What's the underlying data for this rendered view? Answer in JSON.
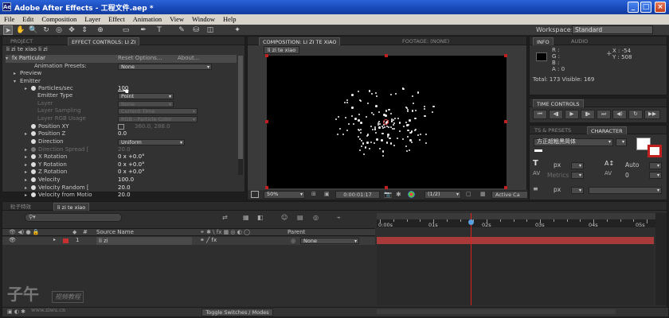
{
  "app": {
    "title": "Adobe After Effects - 工程文件.aep *",
    "minimize": "_",
    "maximize": "□",
    "close": "×"
  },
  "menu": [
    "File",
    "Edit",
    "Composition",
    "Layer",
    "Effect",
    "Animation",
    "View",
    "Window",
    "Help"
  ],
  "toolbar": {
    "workspace_label": "Workspace:",
    "workspace_value": "Standard"
  },
  "left_panel": {
    "tabs": [
      "PROJECT",
      "EFFECT CONTROLS: li zi"
    ],
    "breadcrumb": "li zi te xiao  li zi",
    "effect_name": "Particular",
    "reset": "Reset Options...",
    "about": "About...",
    "presets_label": "Animation Presets:",
    "presets_value": "None",
    "sections": {
      "preview": "Preview",
      "emitter": "Emitter"
    },
    "properties": [
      {
        "label": "Particles/sec",
        "value": "100"
      },
      {
        "label": "Emitter Type",
        "value": "Point"
      },
      {
        "label": "Layer",
        "value": "None"
      },
      {
        "label": "Layer Sampling",
        "value": "Current Time"
      },
      {
        "label": "Layer RGB Usage",
        "value": "RGB - Particle Color"
      },
      {
        "label": "Position XY",
        "value": "360.0, 288.0"
      },
      {
        "label": "Position Z",
        "value": "0.0"
      },
      {
        "label": "Direction",
        "value": "Uniform"
      },
      {
        "label": "Direction Spread [",
        "value": "20.0"
      },
      {
        "label": "X Rotation",
        "value": "0 x +0.0°"
      },
      {
        "label": "Y Rotation",
        "value": "0 x +0.0°"
      },
      {
        "label": "Z Rotation",
        "value": "0 x +0.0°"
      },
      {
        "label": "Velocity",
        "value": "100.0"
      },
      {
        "label": "Velocity Random [",
        "value": "20.0"
      },
      {
        "label": "Velocity from Motio",
        "value": "20.0"
      }
    ]
  },
  "comp_panel": {
    "tab_active": "COMPOSITION: li zi te xiao",
    "tab_footage": "FOOTAGE: (none)",
    "comp_name": "li zi te xiao",
    "zoom": "50%",
    "timecode": "0:00:01:17",
    "resolution": "(1/2)",
    "view": "Active Ca"
  },
  "info_panel": {
    "tabs": [
      "INFO",
      "AUDIO"
    ],
    "r": "R :",
    "g": "G :",
    "b": "B :",
    "a": "A : 0",
    "x": "X : -54",
    "y": "Y : 508",
    "total": "Total: 173   Visible: 169"
  },
  "time_controls": {
    "tab": "TIME CONTROLS"
  },
  "character_panel": {
    "tabs": [
      "TS & PRESETS",
      "CHARACTER"
    ],
    "font": "方正超粗黑简体",
    "font_size": "px",
    "leading": "Auto",
    "tracking": "0",
    "metrics": "Metrics",
    "stroke": "px"
  },
  "timeline": {
    "tabs": [
      "粒子特效",
      "li zi te xiao"
    ],
    "search_placeholder": "",
    "col_num": "#",
    "col_source": "Source Name",
    "col_parent": "Parent",
    "layer_num": "1",
    "layer_name": "li zi",
    "parent_value": "None",
    "ruler": [
      "0:00s",
      "01s",
      "02s",
      "03s",
      "04s",
      "05s"
    ],
    "playhead_time": "1.7",
    "toggle_label": "Toggle Switches / Modes"
  },
  "watermark": {
    "text1": "子午",
    "text2": "视频教程",
    "url": "www.ziwu.cn"
  },
  "colors": {
    "layer_label": "#c83030",
    "layer_bar": "#a83a3a",
    "playhead": "#e02020"
  }
}
